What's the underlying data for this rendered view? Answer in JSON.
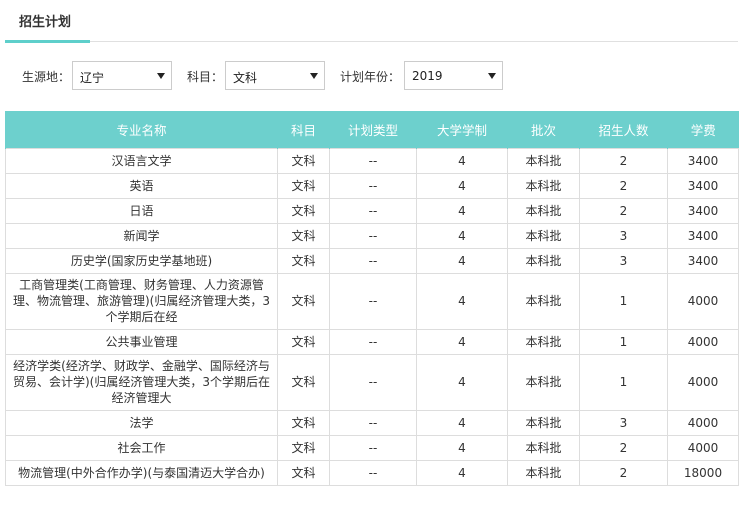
{
  "tab": {
    "label": "招生计划"
  },
  "filters": {
    "province_label": "生源地：",
    "province_value": "辽宁",
    "subject_label": "科目：",
    "subject_value": "文科",
    "year_label": "计划年份：",
    "year_value": "2019"
  },
  "table": {
    "headers": [
      "专业名称",
      "科目",
      "计划类型",
      "大学学制",
      "批次",
      "招生人数",
      "学费"
    ],
    "rows": [
      [
        "汉语言文学",
        "文科",
        "--",
        "4",
        "本科批",
        "2",
        "3400"
      ],
      [
        "英语",
        "文科",
        "--",
        "4",
        "本科批",
        "2",
        "3400"
      ],
      [
        "日语",
        "文科",
        "--",
        "4",
        "本科批",
        "2",
        "3400"
      ],
      [
        "新闻学",
        "文科",
        "--",
        "4",
        "本科批",
        "3",
        "3400"
      ],
      [
        "历史学(国家历史学基地班)",
        "文科",
        "--",
        "4",
        "本科批",
        "3",
        "3400"
      ],
      [
        "工商管理类(工商管理、财务管理、人力资源管理、物流管理、旅游管理)(归属经济管理大类，3个学期后在经",
        "文科",
        "--",
        "4",
        "本科批",
        "1",
        "4000"
      ],
      [
        "公共事业管理",
        "文科",
        "--",
        "4",
        "本科批",
        "1",
        "4000"
      ],
      [
        "经济学类(经济学、财政学、金融学、国际经济与贸易、会计学)(归属经济管理大类，3个学期后在经济管理大",
        "文科",
        "--",
        "4",
        "本科批",
        "1",
        "4000"
      ],
      [
        "法学",
        "文科",
        "--",
        "4",
        "本科批",
        "3",
        "4000"
      ],
      [
        "社会工作",
        "文科",
        "--",
        "4",
        "本科批",
        "2",
        "4000"
      ],
      [
        "物流管理(中外合作办学)(与泰国清迈大学合办)",
        "文科",
        "--",
        "4",
        "本科批",
        "2",
        "18000"
      ]
    ]
  }
}
